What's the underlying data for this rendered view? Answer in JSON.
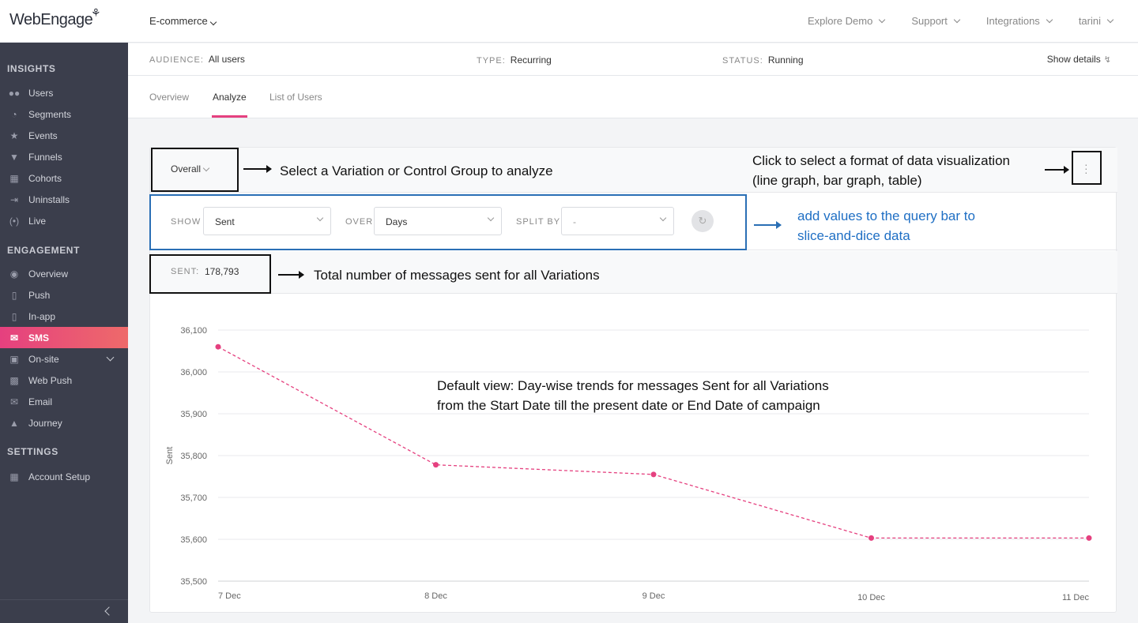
{
  "brand": {
    "logo_text": "WebEngage"
  },
  "topbar": {
    "project": "E-commerce",
    "nav": [
      "Explore Demo",
      "Support",
      "Integrations",
      "tarini"
    ]
  },
  "sidebar": {
    "sections": [
      {
        "title": "INSIGHTS",
        "items": [
          {
            "label": "Users",
            "icon": "users-icon"
          },
          {
            "label": "Segments",
            "icon": "pie-icon"
          },
          {
            "label": "Events",
            "icon": "star-icon"
          },
          {
            "label": "Funnels",
            "icon": "funnel-icon"
          },
          {
            "label": "Cohorts",
            "icon": "grid-icon"
          },
          {
            "label": "Uninstalls",
            "icon": "exit-icon"
          },
          {
            "label": "Live",
            "icon": "broadcast-icon"
          }
        ]
      },
      {
        "title": "ENGAGEMENT",
        "items": [
          {
            "label": "Overview",
            "icon": "eye-icon"
          },
          {
            "label": "Push",
            "icon": "mobile-push-icon"
          },
          {
            "label": "In-app",
            "icon": "mobile-icon"
          },
          {
            "label": "SMS",
            "icon": "sms-icon",
            "active": true
          },
          {
            "label": "On-site",
            "icon": "onsite-icon",
            "expandable": true
          },
          {
            "label": "Web Push",
            "icon": "webpush-icon"
          },
          {
            "label": "Email",
            "icon": "mail-icon"
          },
          {
            "label": "Journey",
            "icon": "journey-icon"
          }
        ]
      },
      {
        "title": "SETTINGS",
        "items": [
          {
            "label": "Account Setup",
            "icon": "dashboard-icon"
          }
        ]
      }
    ]
  },
  "info": {
    "audience_key": "AUDIENCE:",
    "audience_value": "All users",
    "type_key": "TYPE:",
    "type_value": "Recurring",
    "status_key": "STATUS:",
    "status_value": "Running",
    "details_label": "Show details"
  },
  "tabs": [
    "Overview",
    "Analyze",
    "List of Users"
  ],
  "active_tab": "Analyze",
  "analyze": {
    "variation_select": "Overall",
    "query": {
      "show_label": "SHOW",
      "show_value": "Sent",
      "over_label": "OVER",
      "over_value": "Days",
      "split_label": "SPLIT BY",
      "split_value": "-"
    },
    "total_key": "SENT:",
    "total_value": "178,793"
  },
  "annotations": {
    "variation": "Select a Variation or Control Group to analyze",
    "format_line1": "Click to select a format of data visualization",
    "format_line2": "(line graph, bar graph, table)",
    "query_line1": "add values to the query bar to",
    "query_line2": "slice-and-dice data",
    "total": "Total number of messages sent for all Variations",
    "default_line1": "Default view: Day-wise trends for messages Sent for all Variations",
    "default_line2": "from the Start Date till the present date or End Date of campaign"
  },
  "colors": {
    "accent": "#e5407f",
    "sidebar": "#3b3e4c",
    "annotation_blue": "#1f6fc4"
  },
  "chart_data": {
    "type": "line",
    "categories": [
      "7 Dec",
      "8 Dec",
      "9 Dec",
      "10 Dec",
      "11 Dec"
    ],
    "series": [
      {
        "values": [
          36060,
          35778,
          35755,
          35603,
          35603
        ]
      }
    ],
    "ylabel": "Sent",
    "ylim": [
      35500,
      36100
    ],
    "yticks": [
      35500,
      35600,
      35700,
      35800,
      35900,
      36000,
      36100
    ],
    "ytick_labels": [
      "35,500",
      "35,600",
      "35,700",
      "35,800",
      "35,900",
      "36,000",
      "36,100"
    ],
    "line_style": "dashed",
    "grid": true,
    "color": "#e5407f"
  }
}
